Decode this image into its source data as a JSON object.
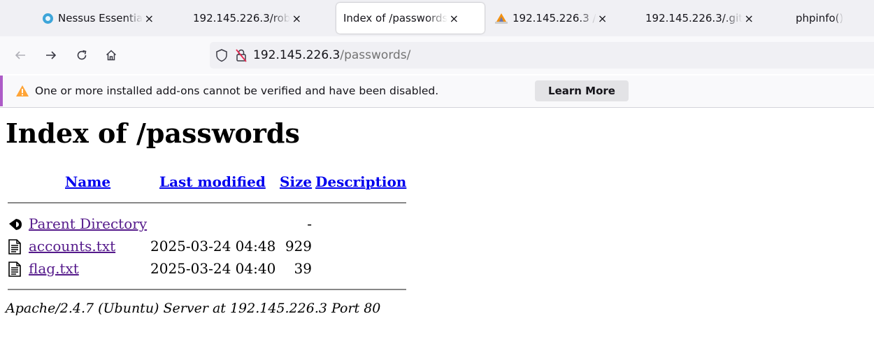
{
  "browser": {
    "tabs": [
      {
        "title": "Nessus Essentia",
        "favicon": "nessus-icon",
        "active": false
      },
      {
        "title": "192.145.226.3/rob",
        "favicon": "",
        "active": false
      },
      {
        "title": "Index of /passwords",
        "favicon": "",
        "active": true
      },
      {
        "title": "192.145.226.3 /",
        "favicon": "phpmyadmin-icon",
        "active": false
      },
      {
        "title": "192.145.226.3/.git",
        "favicon": "",
        "active": false
      },
      {
        "title": "phpinfo()",
        "favicon": "",
        "active": false
      }
    ],
    "close_glyph": "×",
    "url_host": "192.145.226.3",
    "url_path": "/passwords/"
  },
  "notification": {
    "message": "One or more installed add-ons cannot be verified and have been disabled.",
    "button_label": "Learn More"
  },
  "page": {
    "heading": "Index of /passwords",
    "columns": {
      "name": "Name",
      "last_modified": "Last modified",
      "size": "Size",
      "description": "Description"
    },
    "entries": [
      {
        "name": "Parent Directory",
        "date": "",
        "size": "-",
        "icon": "back-arrow-icon"
      },
      {
        "name": "accounts.txt",
        "date": "2025-03-24 04:48",
        "size": "929",
        "icon": "text-file-icon"
      },
      {
        "name": "flag.txt",
        "date": "2025-03-24 04:40",
        "size": "39",
        "icon": "text-file-icon"
      }
    ],
    "address": "Apache/2.4.7 (Ubuntu) Server at 192.145.226.3 Port 80"
  }
}
